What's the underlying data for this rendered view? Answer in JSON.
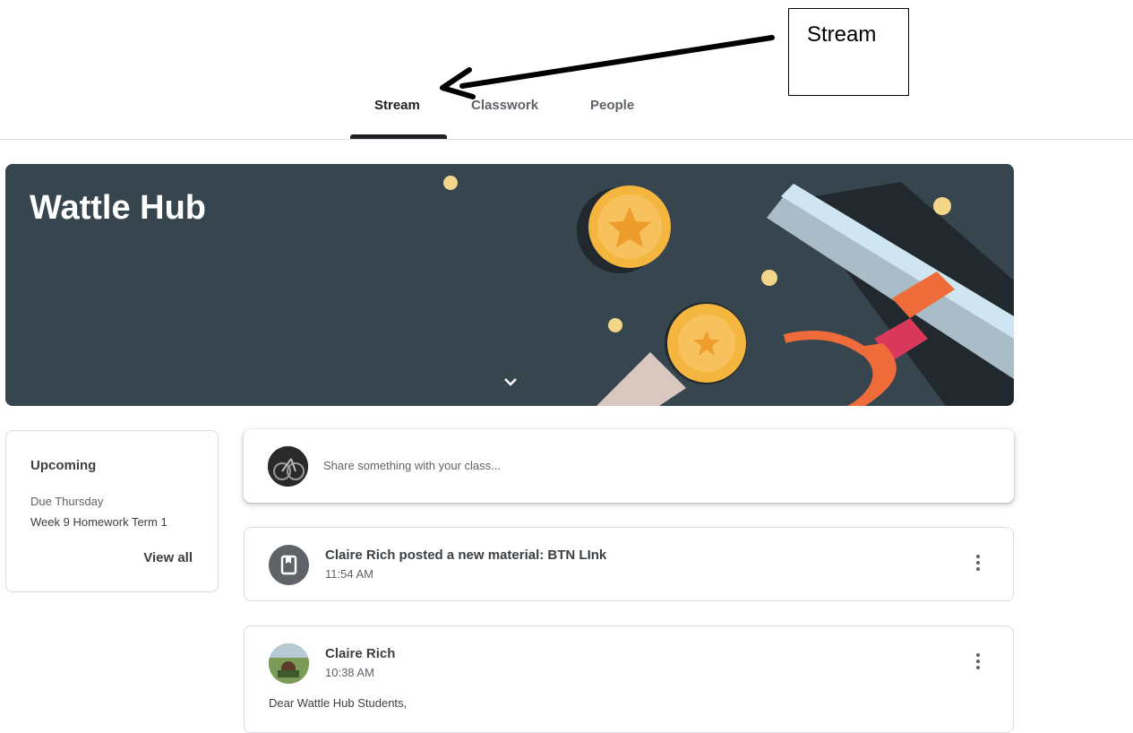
{
  "tabs": [
    {
      "label": "Stream",
      "active": true
    },
    {
      "label": "Classwork",
      "active": false
    },
    {
      "label": "People",
      "active": false
    }
  ],
  "annotation": {
    "label": "Stream"
  },
  "banner": {
    "title": "Wattle Hub",
    "background": "#37454e"
  },
  "upcoming": {
    "title": "Upcoming",
    "due": "Due Thursday",
    "item": "Week 9 Homework Term 1",
    "view_all": "View all"
  },
  "share": {
    "placeholder": "Share something with your class..."
  },
  "posts": [
    {
      "header": "Claire Rich posted a new material: BTN LInk",
      "time": "11:54 AM",
      "icon": "material-book-icon"
    },
    {
      "header": "Claire Rich",
      "time": "10:38 AM",
      "body": "Dear Wattle Hub Students,",
      "icon": "avatar"
    }
  ],
  "colors": {
    "accent_tab": "#202124",
    "text": "#3c4043",
    "muted": "#5f6368",
    "coin": "#f4b63f",
    "ribbon": "#ef6b3a"
  }
}
